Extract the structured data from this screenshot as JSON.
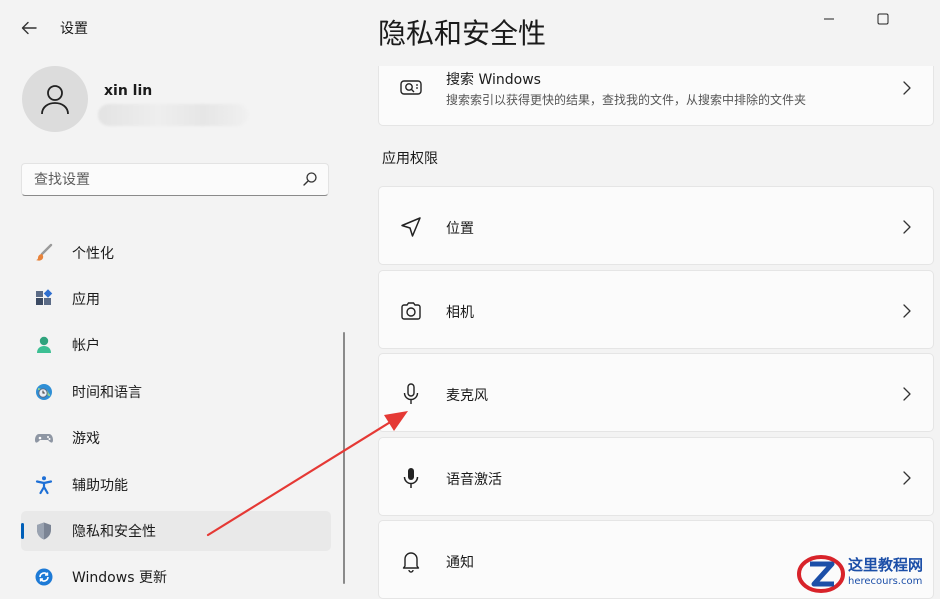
{
  "app": {
    "title": "设置"
  },
  "account": {
    "name": "xin lin"
  },
  "search": {
    "placeholder": "查找设置"
  },
  "sidebar": {
    "items": [
      {
        "label": "个性化",
        "icon": "brush-icon"
      },
      {
        "label": "应用",
        "icon": "apps-icon"
      },
      {
        "label": "帐户",
        "icon": "person-icon"
      },
      {
        "label": "时间和语言",
        "icon": "globe-clock-icon"
      },
      {
        "label": "游戏",
        "icon": "gamepad-icon"
      },
      {
        "label": "辅助功能",
        "icon": "accessibility-icon"
      },
      {
        "label": "隐私和安全性",
        "icon": "shield-icon",
        "selected": true
      },
      {
        "label": "Windows 更新",
        "icon": "windows-update-icon"
      }
    ]
  },
  "main": {
    "title": "隐私和安全性",
    "search_windows": {
      "title": "搜索 Windows",
      "subtitle": "搜索索引以获得更快的结果，查找我的文件，从搜索中排除的文件夹"
    },
    "section_label": "应用权限",
    "permissions": [
      {
        "label": "位置",
        "icon": "location-icon"
      },
      {
        "label": "相机",
        "icon": "camera-icon"
      },
      {
        "label": "麦克风",
        "icon": "microphone-icon"
      },
      {
        "label": "语音激活",
        "icon": "voice-activation-icon"
      },
      {
        "label": "通知",
        "icon": "bell-icon"
      }
    ]
  },
  "watermark": {
    "name": "这里教程网",
    "url": "herecours.com"
  },
  "colors": {
    "accent": "#005fb8",
    "annotation_arrow": "#e53935",
    "watermark": "#1c4fa8"
  }
}
